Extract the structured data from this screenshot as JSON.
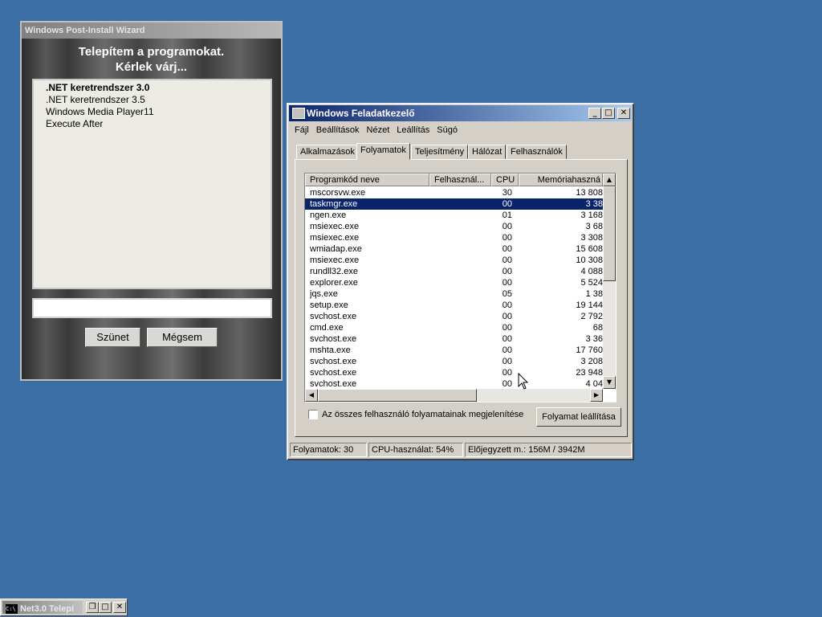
{
  "wizard": {
    "title": "Windows Post-Install Wizard",
    "heading_line1": "Telepítem a programokat.",
    "heading_line2": "Kérlek várj...",
    "items": [
      ".NET keretrendszer 3.0",
      ".NET keretrendszer 3.5",
      "Windows Media Player11",
      "Execute After"
    ],
    "current_item_index": 0,
    "pause_label": "Szünet",
    "cancel_label": "Mégsem"
  },
  "taskmgr": {
    "title": "Windows Feladatkezelő",
    "title_buttons": [
      "_",
      "□",
      "✕"
    ],
    "menu": [
      "Fájl",
      "Beállítások",
      "Nézet",
      "Leállítás",
      "Súgó"
    ],
    "tabs": [
      "Alkalmazások",
      "Folyamatok",
      "Teljesítmény",
      "Hálózat",
      "Felhasználók"
    ],
    "selected_tab": "Folyamatok",
    "columns": [
      "Programkód neve",
      "Felhasznál...",
      "CPU",
      "Memóriahaszná"
    ],
    "processes": [
      {
        "name": "mscorsvw.exe",
        "cpu": "30",
        "mem": "13 808"
      },
      {
        "name": "taskmgr.exe",
        "cpu": "00",
        "mem": "3 38"
      },
      {
        "name": "ngen.exe",
        "cpu": "01",
        "mem": "3 168"
      },
      {
        "name": "msiexec.exe",
        "cpu": "00",
        "mem": "3 68"
      },
      {
        "name": "msiexec.exe",
        "cpu": "00",
        "mem": "3 308"
      },
      {
        "name": "wmiadap.exe",
        "cpu": "00",
        "mem": "15 608"
      },
      {
        "name": "msiexec.exe",
        "cpu": "00",
        "mem": "10 308"
      },
      {
        "name": "rundll32.exe",
        "cpu": "00",
        "mem": "4 088"
      },
      {
        "name": "explorer.exe",
        "cpu": "00",
        "mem": "5 524"
      },
      {
        "name": "jqs.exe",
        "cpu": "05",
        "mem": "1 38"
      },
      {
        "name": "setup.exe",
        "cpu": "00",
        "mem": "19 144"
      },
      {
        "name": "svchost.exe",
        "cpu": "00",
        "mem": "2 792"
      },
      {
        "name": "cmd.exe",
        "cpu": "00",
        "mem": "68"
      },
      {
        "name": "svchost.exe",
        "cpu": "00",
        "mem": "3 36"
      },
      {
        "name": "mshta.exe",
        "cpu": "00",
        "mem": "17 760"
      },
      {
        "name": "svchost.exe",
        "cpu": "00",
        "mem": "3 208"
      },
      {
        "name": "svchost.exe",
        "cpu": "00",
        "mem": "23 948"
      },
      {
        "name": "svchost.exe",
        "cpu": "00",
        "mem": "4 04"
      }
    ],
    "selected_process_index": 1,
    "show_all_label": "Az összes felhasználó folyamatainak megjelenítése",
    "end_process_label": "Folyamat leállítása",
    "status": {
      "processes": "Folyamatok: 30",
      "cpu": "CPU-használat: 54%",
      "commit": "Előjegyzett m.: 156M / 3942M"
    }
  },
  "taskbar": {
    "cmd_title": "Net3.0 Telepí"
  }
}
